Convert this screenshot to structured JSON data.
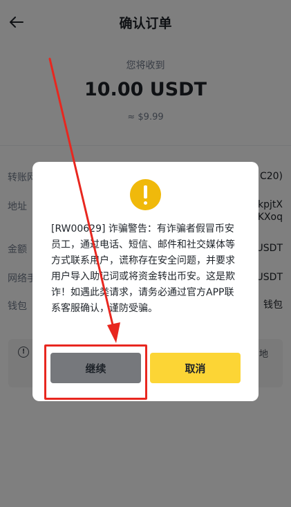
{
  "header": {
    "title": "确认订单"
  },
  "summary": {
    "receive_label": "您将收到",
    "amount": "10.00 USDT",
    "fiat": "≈ $9.99"
  },
  "details": [
    {
      "label": "转账网",
      "value": "C20)"
    },
    {
      "label": "地址",
      "value": "kpjtX\nKXoq"
    },
    {
      "label": "金额",
      "value": "USDT"
    },
    {
      "label": "网络手",
      "value": "USDT"
    },
    {
      "label": "钱包",
      "value": "钱包"
    }
  ],
  "info": {
    "text": "地"
  },
  "dialog": {
    "message": "[RW00629] 诈骗警告：有诈骗者假冒币安员工，通过电话、短信、邮件和社交媒体等方式联系用户，谎称存在安全问题，并要求用户导入助记词或将资金转出币安。这是欺诈！如遇此类请求，请务必通过官方APP联系客服确认，谨防受骗。",
    "continue_label": "继续",
    "cancel_label": "取消"
  },
  "colors": {
    "accent_yellow": "#fcd535",
    "warning_icon": "#f0b90b",
    "annotation_red": "#e8271f"
  }
}
